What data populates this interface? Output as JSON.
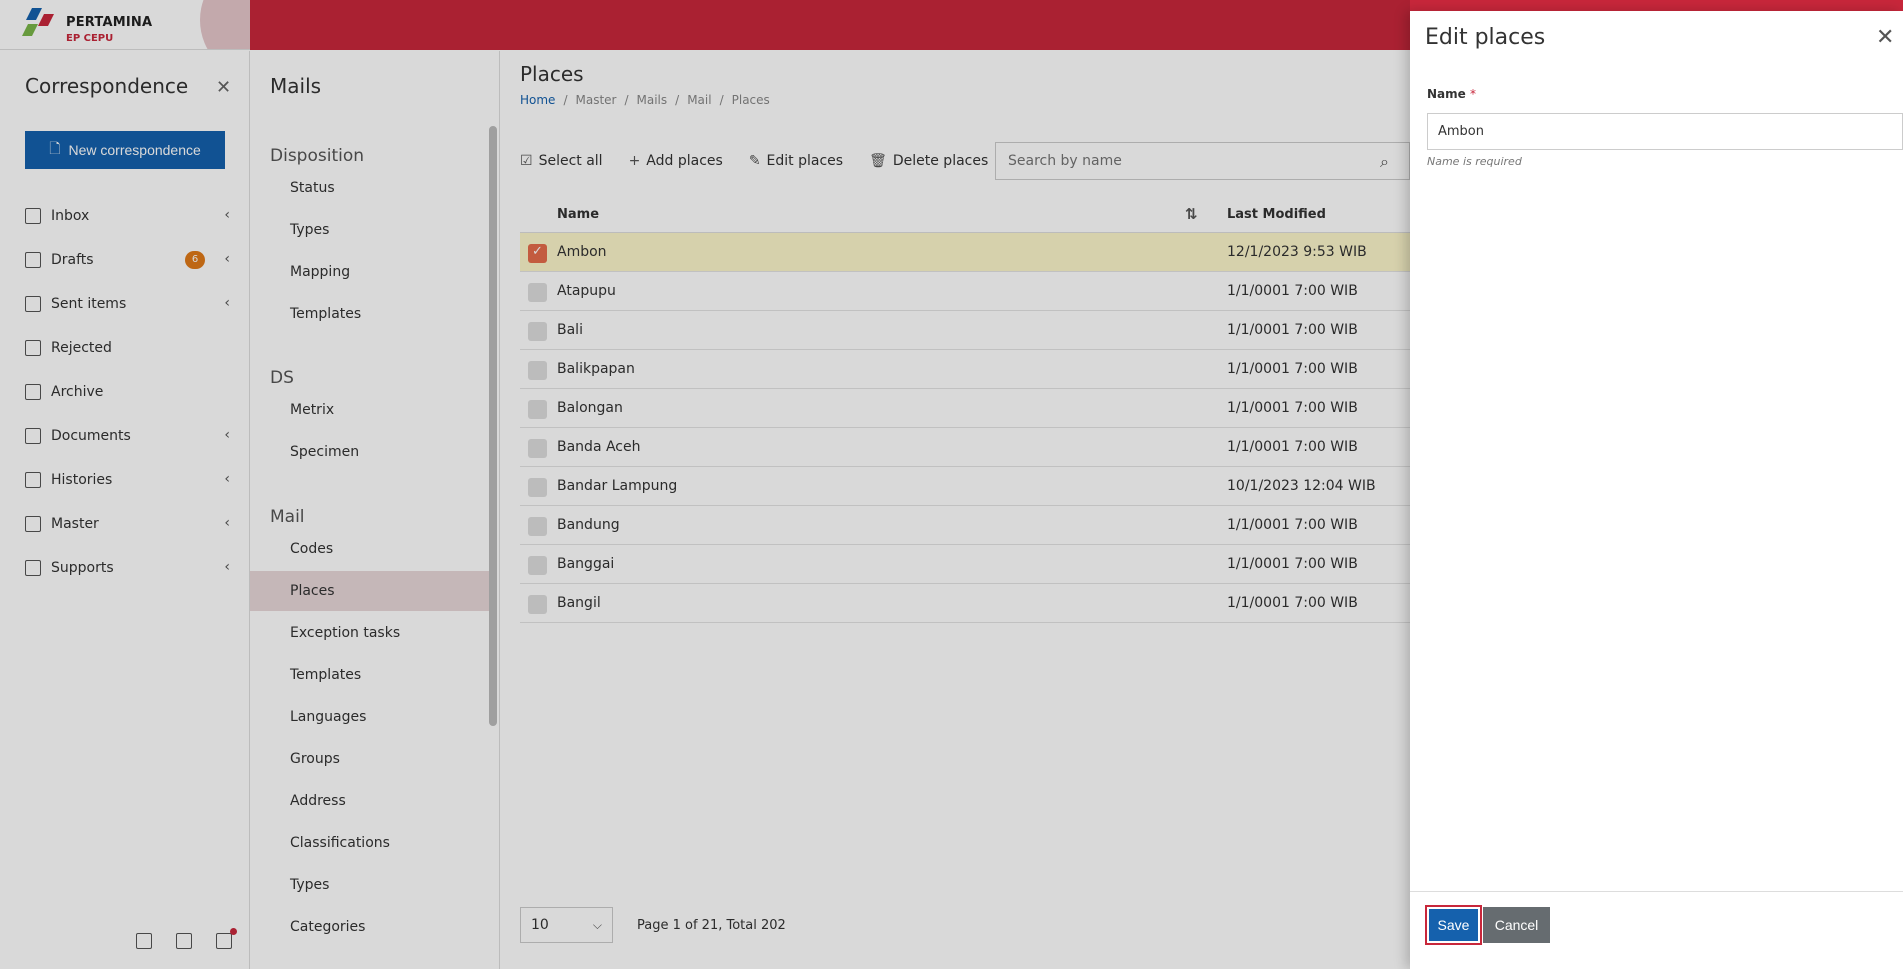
{
  "brand": {
    "name": "PERTAMINA",
    "sub": "EP CEPU"
  },
  "leftnav": {
    "title": "Correspondence",
    "new_label": "New correspondence",
    "items": [
      {
        "label": "Inbox",
        "icon": "inbox-icon",
        "chevron": true
      },
      {
        "label": "Drafts",
        "icon": "drafts-icon",
        "chevron": true,
        "badge": "6"
      },
      {
        "label": "Sent items",
        "icon": "send-icon",
        "chevron": true
      },
      {
        "label": "Rejected",
        "icon": "rejected-icon",
        "chevron": false
      },
      {
        "label": "Archive",
        "icon": "archive-icon",
        "chevron": false
      },
      {
        "label": "Documents",
        "icon": "documents-icon",
        "chevron": true
      },
      {
        "label": "Histories",
        "icon": "history-icon",
        "chevron": true
      },
      {
        "label": "Master",
        "icon": "master-icon",
        "chevron": true
      },
      {
        "label": "Supports",
        "icon": "supports-icon",
        "chevron": true
      }
    ]
  },
  "subnav": {
    "title": "Mails",
    "groups": [
      {
        "label": "Disposition",
        "items": [
          "Status",
          "Types",
          "Mapping",
          "Templates"
        ]
      },
      {
        "label": "DS",
        "items": [
          "Metrix",
          "Specimen"
        ]
      },
      {
        "label": "Mail",
        "items": [
          "Codes",
          "Places",
          "Exception tasks",
          "Templates",
          "Languages",
          "Groups",
          "Address",
          "Classifications",
          "Types",
          "Categories"
        ]
      }
    ],
    "active": "Places"
  },
  "main": {
    "title": "Places",
    "breadcrumb": [
      "Home",
      "Master",
      "Mails",
      "Mail",
      "Places"
    ],
    "toolbar": {
      "select_all": "Select all",
      "add": "Add places",
      "edit": "Edit places",
      "delete": "Delete places",
      "search_placeholder": "Search by name"
    },
    "columns": {
      "name": "Name",
      "modified": "Last Modified"
    },
    "rows": [
      {
        "name": "Ambon",
        "modified": "12/1/2023 9:53 WIB",
        "selected": true
      },
      {
        "name": "Atapupu",
        "modified": "1/1/0001 7:00 WIB",
        "selected": false
      },
      {
        "name": "Bali",
        "modified": "1/1/0001 7:00 WIB",
        "selected": false
      },
      {
        "name": "Balikpapan",
        "modified": "1/1/0001 7:00 WIB",
        "selected": false
      },
      {
        "name": "Balongan",
        "modified": "1/1/0001 7:00 WIB",
        "selected": false
      },
      {
        "name": "Banda Aceh",
        "modified": "1/1/0001 7:00 WIB",
        "selected": false
      },
      {
        "name": "Bandar Lampung",
        "modified": "10/1/2023 12:04 WIB",
        "selected": false
      },
      {
        "name": "Bandung",
        "modified": "1/1/0001 7:00 WIB",
        "selected": false
      },
      {
        "name": "Banggai",
        "modified": "1/1/0001 7:00 WIB",
        "selected": false
      },
      {
        "name": "Bangil",
        "modified": "1/1/0001 7:00 WIB",
        "selected": false
      }
    ],
    "pager": {
      "page_size": "10",
      "info": "Page 1 of 21, Total 202"
    }
  },
  "drawer": {
    "title": "Edit places",
    "name_label": "Name",
    "required_mark": "*",
    "name_value": "Ambon",
    "hint": "Name is required",
    "save_label": "Save",
    "cancel_label": "Cancel"
  },
  "colors": {
    "brand_red": "#c8273b",
    "primary_blue": "#1561ad"
  }
}
